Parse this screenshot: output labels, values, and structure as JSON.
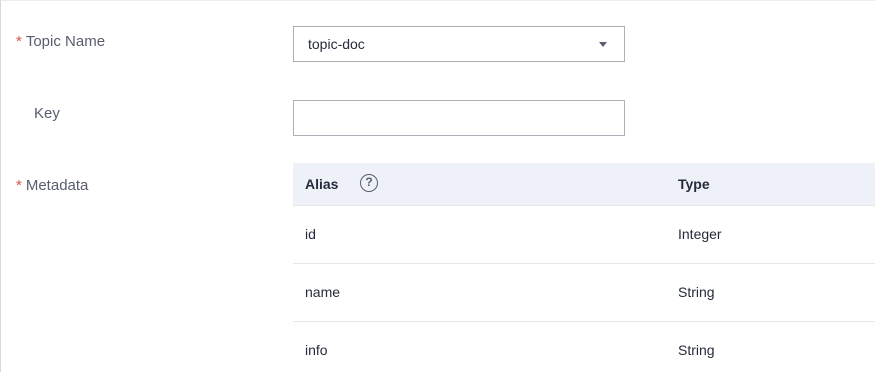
{
  "form": {
    "topic": {
      "required_mark": "*",
      "label": "Topic Name",
      "value": "topic-doc"
    },
    "key": {
      "label": "Key",
      "value": ""
    },
    "metadata": {
      "required_mark": "*",
      "label": "Metadata",
      "columns": {
        "alias": "Alias",
        "alias_help": "?",
        "type": "Type"
      },
      "rows": [
        {
          "alias": "id",
          "type": "Integer"
        },
        {
          "alias": "name",
          "type": "String"
        },
        {
          "alias": "info",
          "type": "String"
        }
      ]
    }
  },
  "icons": {
    "topic_dropdown": "chevron-down-icon",
    "alias_help": "question-circle-icon"
  },
  "colors": {
    "required": "#e44d4d",
    "table_header_bg": "#eef2f8",
    "border": "#adb0b8"
  }
}
